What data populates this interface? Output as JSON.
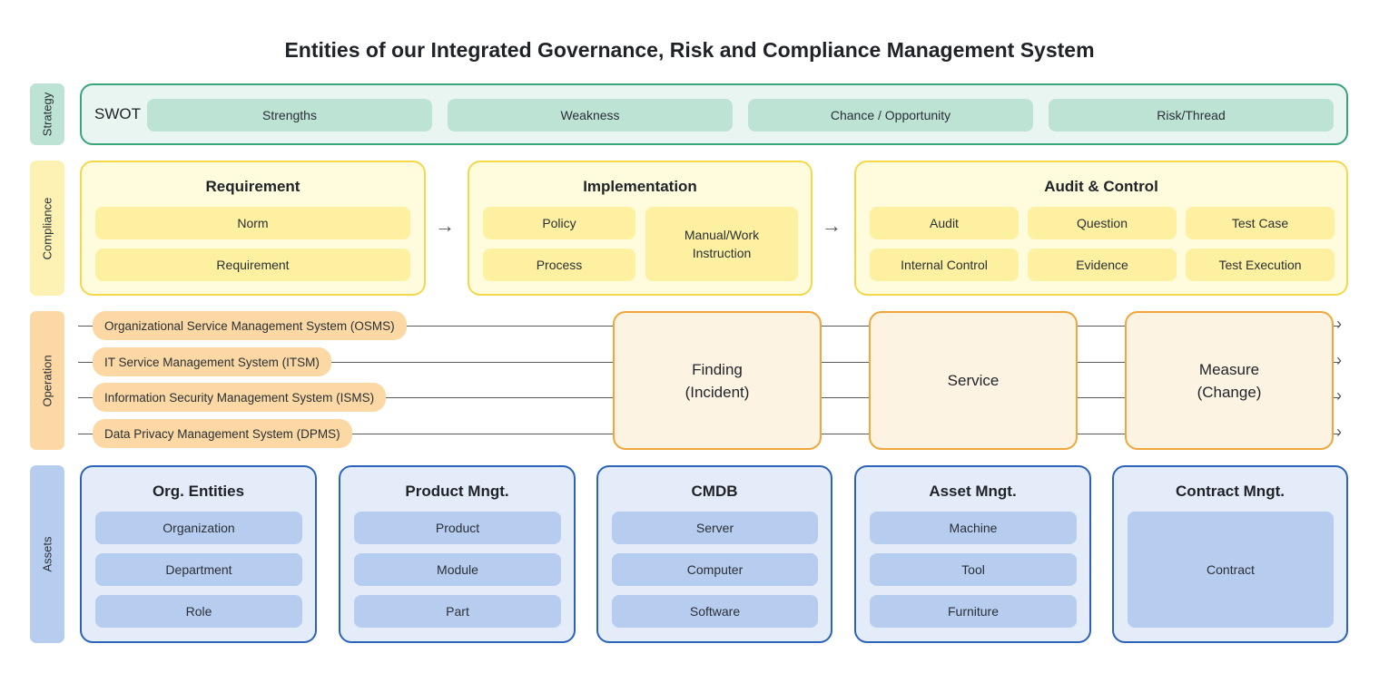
{
  "title": "Entities of our Integrated Governance, Risk and Compliance Management System",
  "layers": {
    "strategy": "Strategy",
    "compliance": "Compliance",
    "operation": "Operation",
    "assets": "Assets"
  },
  "strategy": {
    "label": "SWOT",
    "items": [
      "Strengths",
      "Weakness",
      "Chance / Opportunity",
      "Risk/Thread"
    ]
  },
  "compliance": {
    "requirement": {
      "title": "Requirement",
      "items": [
        "Norm",
        "Requirement"
      ]
    },
    "implementation": {
      "title": "Implementation",
      "items": [
        "Policy",
        "Process",
        "Manual/Work Instruction"
      ]
    },
    "audit": {
      "title": "Audit & Control",
      "items": [
        "Audit",
        "Question",
        "Test Case",
        "Internal Control",
        "Evidence",
        "Test Execution"
      ]
    }
  },
  "operation": {
    "systems": [
      "Organizational Service Management System (OSMS)",
      "IT Service Management System (ITSM)",
      "Information Security Management System (ISMS)",
      "Data Privacy Management System (DPMS)"
    ],
    "stages": [
      {
        "line1": "Finding",
        "line2": "(Incident)"
      },
      {
        "line1": "Service",
        "line2": ""
      },
      {
        "line1": "Measure",
        "line2": "(Change)"
      }
    ]
  },
  "assets": {
    "groups": [
      {
        "title": "Org. Entities",
        "items": [
          "Organization",
          "Department",
          "Role"
        ]
      },
      {
        "title": "Product Mngt.",
        "items": [
          "Product",
          "Module",
          "Part"
        ]
      },
      {
        "title": "CMDB",
        "items": [
          "Server",
          "Computer",
          "Software"
        ]
      },
      {
        "title": "Asset Mngt.",
        "items": [
          "Machine",
          "Tool",
          "Furniture"
        ]
      },
      {
        "title": "Contract Mngt.",
        "items": [
          "Contract"
        ]
      }
    ]
  },
  "colors": {
    "strategy": "#bde3d4",
    "compliance": "#fdf2b3",
    "operation": "#fcd9a4",
    "assets": "#b7cdef",
    "assets_border": "#2a63b8",
    "operation_border": "#f0a63a",
    "compliance_border": "#f2d84a",
    "strategy_border": "#3aa57a"
  },
  "icons": {
    "flow_arrow": "right-arrow-icon"
  }
}
